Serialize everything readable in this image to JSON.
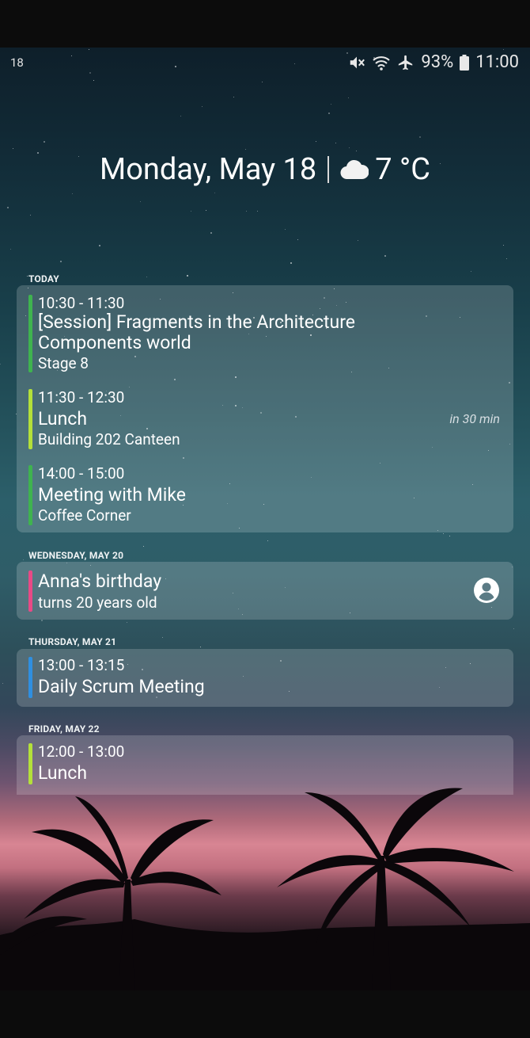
{
  "status_bar": {
    "left_text": "18",
    "icons": [
      "mute-icon",
      "wifi-icon",
      "airplane-icon"
    ],
    "battery": "93%",
    "time": "11:00"
  },
  "header": {
    "date": "Monday, May 18",
    "weather_icon": "cloud-icon",
    "temperature": "7 °C"
  },
  "sections": [
    {
      "label": "TODAY",
      "events": [
        {
          "time": "10:30 - 11:30",
          "title_line1": "[Session] Fragments in the Architecture",
          "title_line2": "Components world",
          "location": "Stage 8",
          "color": "#3fb34f"
        },
        {
          "time": "11:30 - 12:30",
          "title": "Lunch",
          "location": "Building 202 Canteen",
          "note": "in 30 min",
          "color": "#b4e03a"
        },
        {
          "time": "14:00 - 15:00",
          "title": "Meeting with Mike",
          "location": "Coffee Corner",
          "color": "#3fb34f"
        }
      ]
    },
    {
      "label": "WEDNESDAY, MAY 20",
      "events": [
        {
          "title": "Anna's birthday",
          "subtitle": "turns 20 years old",
          "color": "#e84a86",
          "icon": "person-icon"
        }
      ]
    },
    {
      "label": "THURSDAY, MAY 21",
      "events": [
        {
          "time": "13:00 - 13:15",
          "title": "Daily Scrum Meeting",
          "color": "#2f8fe0"
        }
      ]
    },
    {
      "label": "FRIDAY, MAY 22",
      "events": [
        {
          "time": "12:00 - 13:00",
          "title": "Lunch",
          "color": "#b4e03a"
        }
      ]
    }
  ]
}
